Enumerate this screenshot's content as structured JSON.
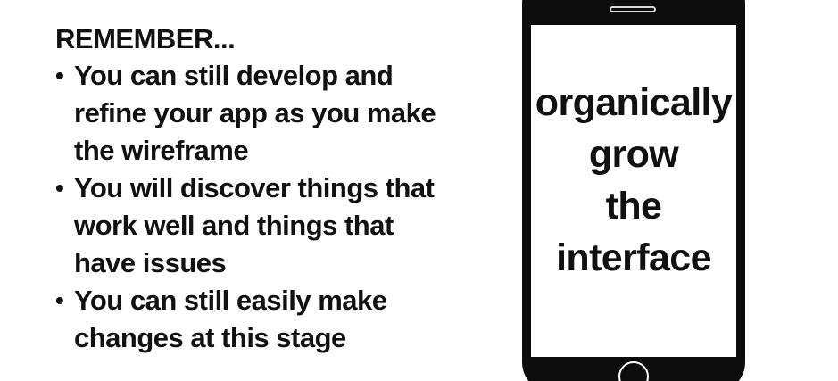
{
  "slide": {
    "heading": "REMEMBER...",
    "bullets": [
      {
        "line1": "You can still develop and",
        "line2": "refine your app as you make",
        "line3": "the wireframe"
      },
      {
        "line1": "You will discover things that",
        "line2": "work well and things that",
        "line3": "have issues"
      },
      {
        "line1": "You can still easily make",
        "line2": "changes at this stage"
      }
    ],
    "bullet_symbol": "•"
  },
  "phone": {
    "screen_lines": [
      "organically",
      "grow",
      "the",
      "interface"
    ],
    "icons": {
      "speaker": "speaker-slot-icon",
      "home": "home-button-icon"
    }
  },
  "colors": {
    "background": "#ffffff",
    "text": "#111111",
    "phone_body": "#0d0d0d"
  }
}
